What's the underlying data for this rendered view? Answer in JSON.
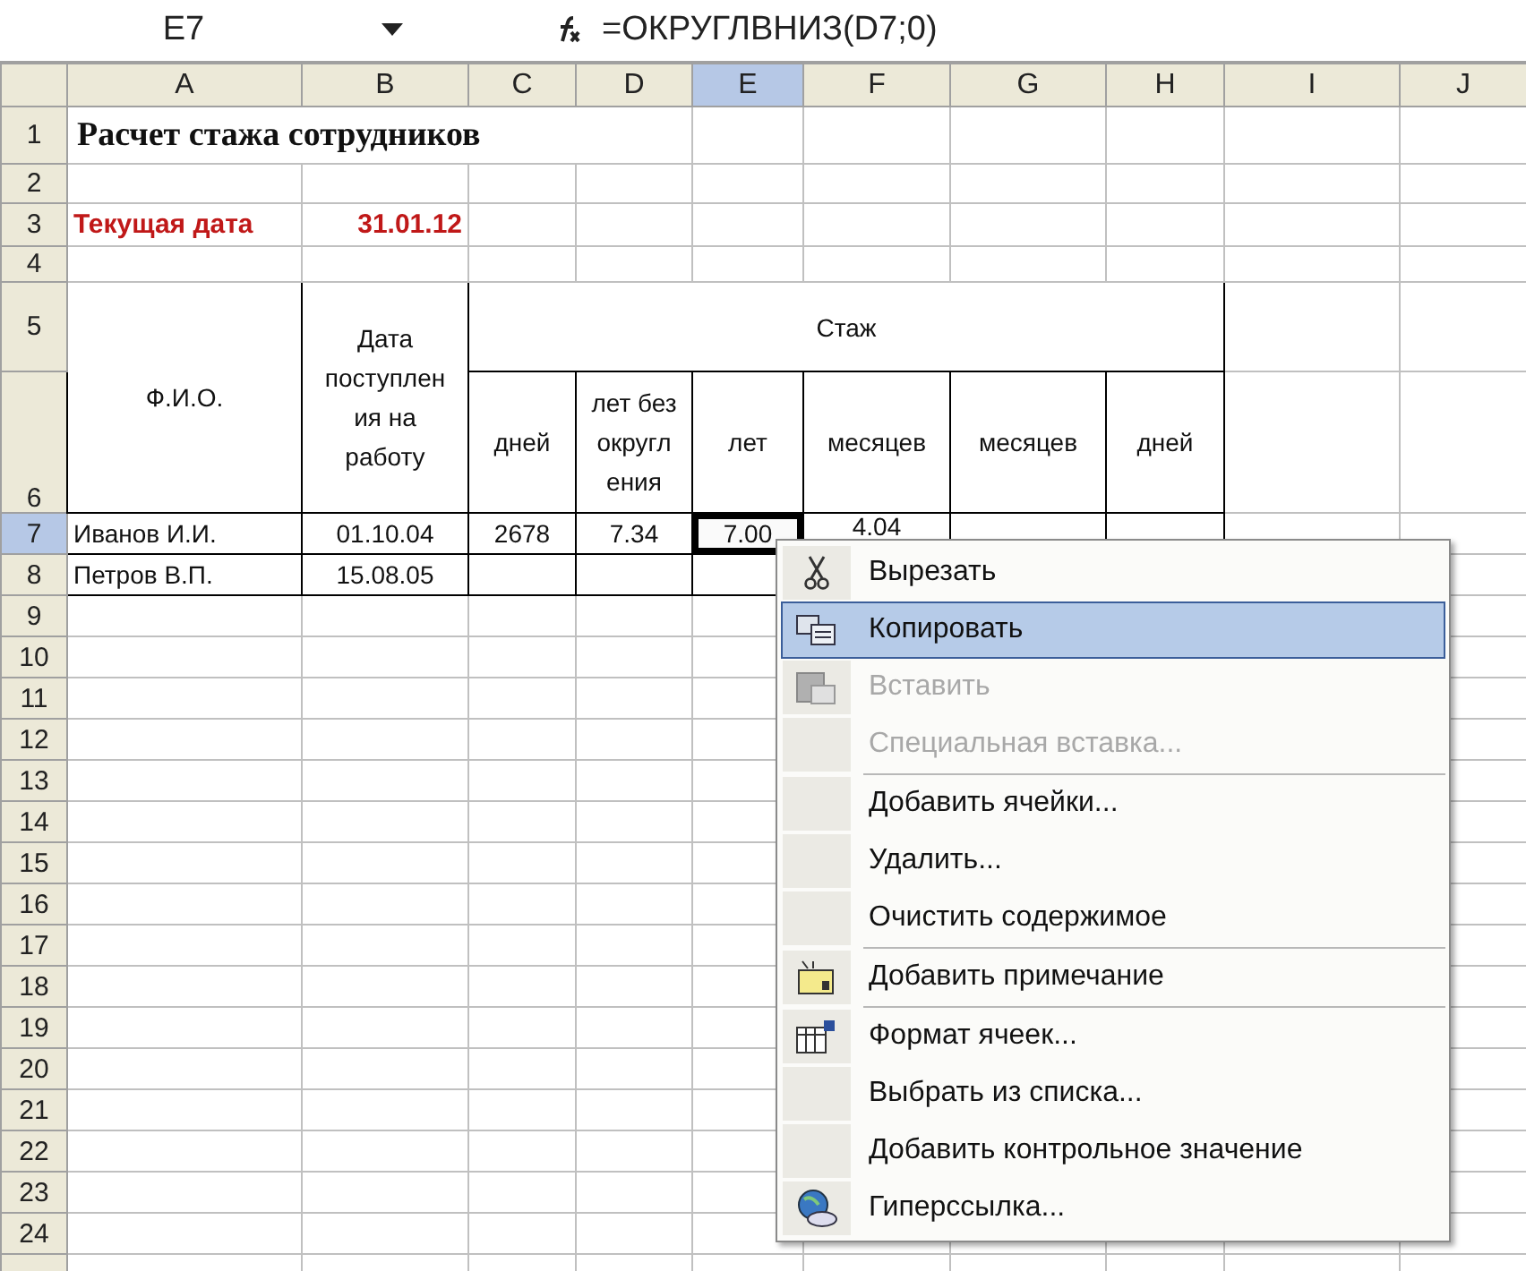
{
  "formula_bar": {
    "cell_reference": "E7",
    "formula": "=ОКРУГЛВНИЗ(D7;0)"
  },
  "column_headers": [
    {
      "label": "A",
      "selected": false
    },
    {
      "label": "B",
      "selected": false
    },
    {
      "label": "C",
      "selected": false
    },
    {
      "label": "D",
      "selected": false
    },
    {
      "label": "E",
      "selected": true
    },
    {
      "label": "F",
      "selected": false
    },
    {
      "label": "G",
      "selected": false
    },
    {
      "label": "H",
      "selected": false
    },
    {
      "label": "I",
      "selected": false
    },
    {
      "label": "J",
      "selected": false
    }
  ],
  "row_headers": [
    {
      "label": "1",
      "selected": false
    },
    {
      "label": "2",
      "selected": false
    },
    {
      "label": "3",
      "selected": false
    },
    {
      "label": "4",
      "selected": false
    },
    {
      "label": "5",
      "selected": false
    },
    {
      "label": "6",
      "selected": false
    },
    {
      "label": "7",
      "selected": true
    },
    {
      "label": "8",
      "selected": false
    },
    {
      "label": "9",
      "selected": false
    },
    {
      "label": "10",
      "selected": false
    },
    {
      "label": "11",
      "selected": false
    },
    {
      "label": "12",
      "selected": false
    },
    {
      "label": "13",
      "selected": false
    },
    {
      "label": "14",
      "selected": false
    },
    {
      "label": "15",
      "selected": false
    },
    {
      "label": "16",
      "selected": false
    },
    {
      "label": "17",
      "selected": false
    },
    {
      "label": "18",
      "selected": false
    },
    {
      "label": "19",
      "selected": false
    },
    {
      "label": "20",
      "selected": false
    },
    {
      "label": "21",
      "selected": false
    },
    {
      "label": "22",
      "selected": false
    },
    {
      "label": "23",
      "selected": false
    },
    {
      "label": "24",
      "selected": false
    }
  ],
  "sheet": {
    "title": "Расчет стажа сотрудников",
    "current_date": {
      "label": "Текущая дата",
      "value": "31.01.12"
    },
    "table": {
      "name_header": "Ф.И.О.",
      "date_header": [
        "Дата",
        "поступлен",
        "ия на",
        "работу"
      ],
      "group_header": "Стаж",
      "subheaders": [
        [
          "дней"
        ],
        [
          "лет без",
          "округл",
          "ения"
        ],
        [
          "лет"
        ],
        [
          "месяцев"
        ],
        [
          "месяцев"
        ],
        [
          "дней"
        ]
      ],
      "rows": [
        {
          "cells": [
            {
              "text": "Иванов И.И.",
              "selected": false
            },
            {
              "text": "01.10.04",
              "selected": false
            },
            {
              "text": "2678",
              "selected": false
            },
            {
              "text": "7.34",
              "selected": false
            },
            {
              "text": "7.00",
              "selected": true
            },
            {
              "text": "4.04",
              "selected": false
            }
          ]
        },
        {
          "cells": [
            {
              "text": "Петров В.П.",
              "selected": false
            },
            {
              "text": "15.08.05",
              "selected": false
            }
          ]
        }
      ]
    }
  },
  "context_menu": {
    "items": [
      {
        "label": "Вырезать",
        "disabled": false,
        "selected": false,
        "separator_before": false
      },
      {
        "label": "Копировать",
        "disabled": false,
        "selected": true,
        "separator_before": false
      },
      {
        "label": "Вставить",
        "disabled": true,
        "selected": false,
        "separator_before": false
      },
      {
        "label": "Специальная вставка...",
        "disabled": true,
        "selected": false,
        "separator_before": false
      },
      {
        "label": "Добавить ячейки...",
        "disabled": false,
        "selected": false,
        "separator_before": true
      },
      {
        "label": "Удалить...",
        "disabled": false,
        "selected": false,
        "separator_before": false
      },
      {
        "label": "Очистить содержимое",
        "disabled": false,
        "selected": false,
        "separator_before": false
      },
      {
        "label": "Добавить примечание",
        "disabled": false,
        "selected": false,
        "separator_before": true
      },
      {
        "label": "Формат ячеек...",
        "disabled": false,
        "selected": false,
        "separator_before": true
      },
      {
        "label": "Выбрать из списка...",
        "disabled": false,
        "selected": false,
        "separator_before": false
      },
      {
        "label": "Добавить контрольное значение",
        "disabled": false,
        "selected": false,
        "separator_before": false
      },
      {
        "label": "Гиперссылка...",
        "disabled": false,
        "selected": false,
        "separator_before": false
      }
    ]
  }
}
